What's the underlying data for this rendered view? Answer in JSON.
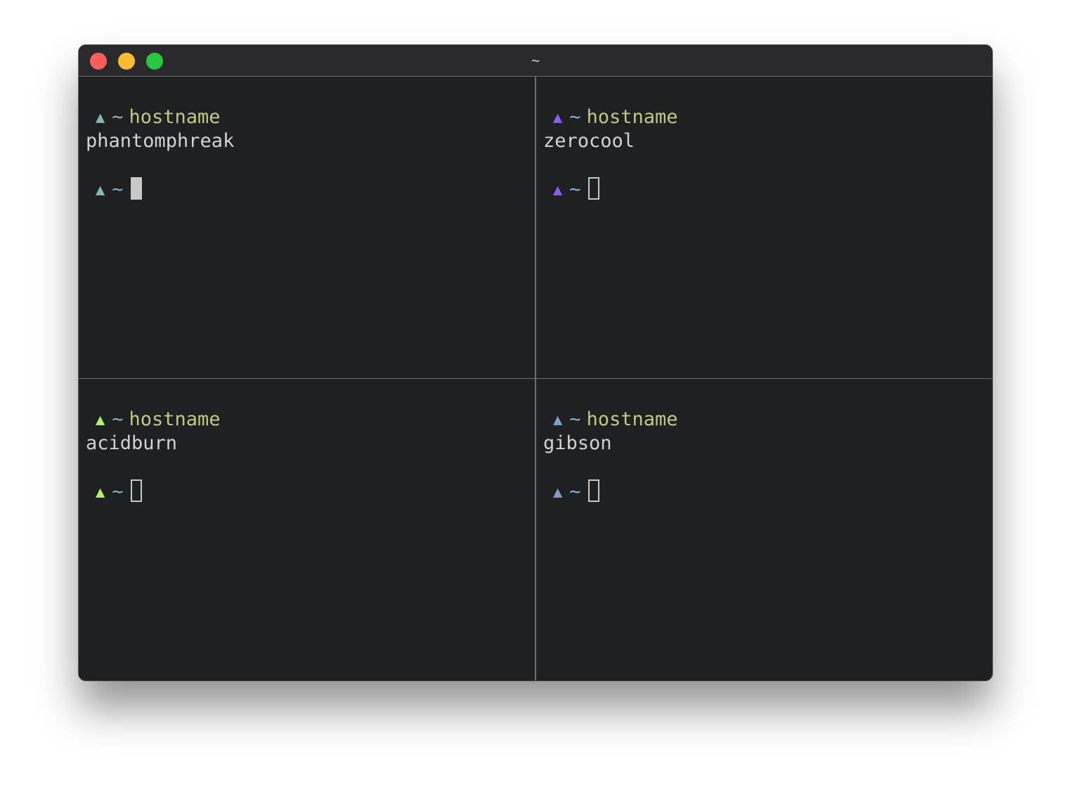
{
  "window": {
    "title": "~"
  },
  "panes": [
    {
      "prompt_symbol": "▲",
      "prompt_color": "#86b7b2",
      "tilde": "~",
      "command": "hostname",
      "output": "phantomphreak",
      "cursor": "block-active"
    },
    {
      "prompt_symbol": "▲",
      "prompt_color": "#8b5cf6",
      "tilde": "~",
      "command": "hostname",
      "output": "zerocool",
      "cursor": "block-inactive"
    },
    {
      "prompt_symbol": "▲",
      "prompt_color": "#b6f26a",
      "tilde": "~",
      "command": "hostname",
      "output": "acidburn",
      "cursor": "block-inactive"
    },
    {
      "prompt_symbol": "▲",
      "prompt_color": "#7b9fc9",
      "tilde": "~",
      "command": "hostname",
      "output": "gibson",
      "cursor": "block-inactive"
    }
  ],
  "colors": {
    "background": "#1f2022",
    "titlebar": "#2a2a2c",
    "divider": "#6e6e6e",
    "tilde": "#86b7c8",
    "command": "#c2c983",
    "output": "#d2d2d2"
  }
}
